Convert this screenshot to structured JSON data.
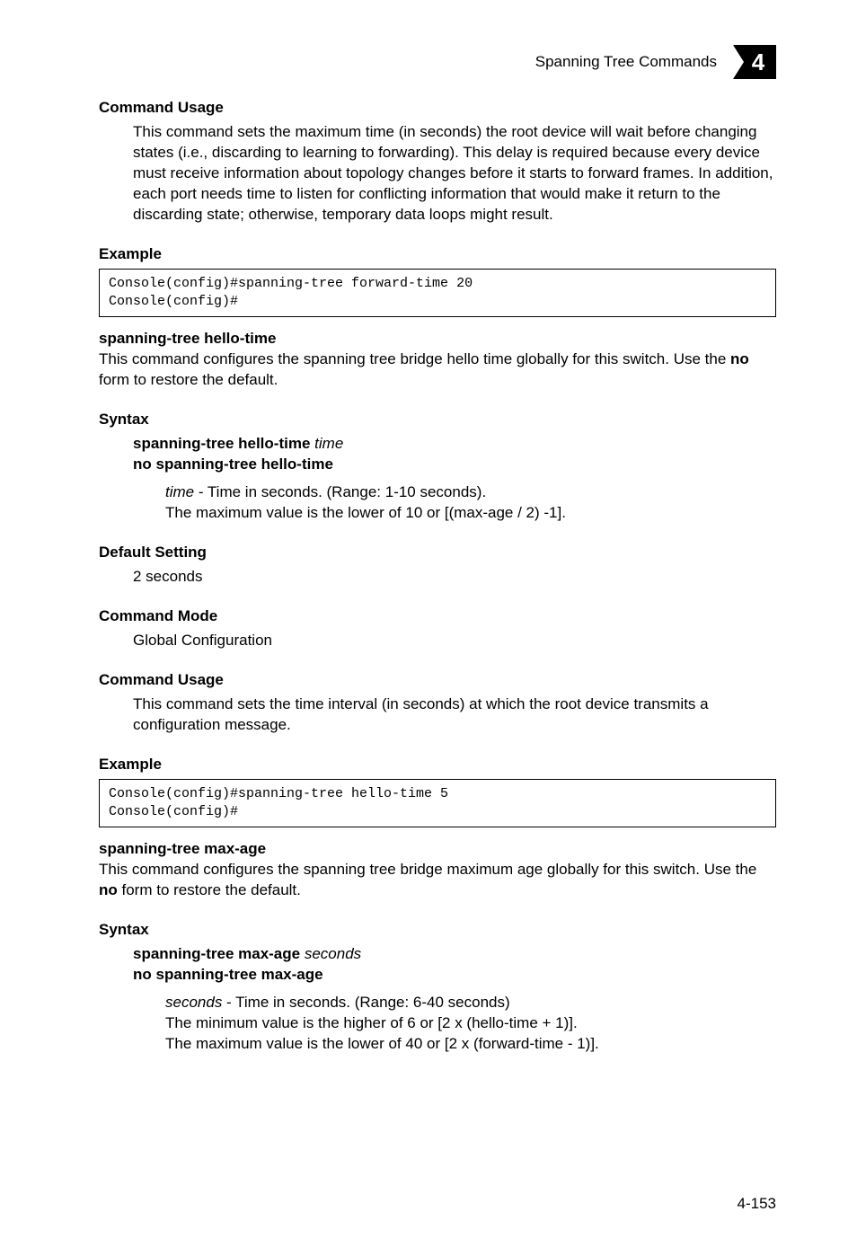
{
  "header": {
    "title": "Spanning Tree Commands",
    "chapter": "4"
  },
  "sec1": {
    "h": "Command Usage",
    "p": "This command sets the maximum time (in seconds) the root device will wait before changing states (i.e., discarding to learning to forwarding). This delay is required because every device must receive information about topology changes before it starts to forward frames. In addition, each port needs time to listen for conflicting information that would make it return to the discarding state; otherwise, temporary data loops might result."
  },
  "ex1": {
    "h": "Example",
    "code": "Console(config)#spanning-tree forward-time 20\nConsole(config)#"
  },
  "cmd1": {
    "name": "spanning-tree hello-time",
    "desc1": "This command configures the spanning tree bridge hello time globally for this switch. Use the ",
    "desc_bold": "no",
    "desc2": " form to restore the default."
  },
  "syn1": {
    "h": "Syntax",
    "l1a": "spanning-tree hello-time",
    "l1b": "time",
    "l2": "no spanning-tree hello-time",
    "p1a": "time",
    "p1b": " - Time in seconds. (Range: 1-10 seconds).",
    "p2": "The maximum value is the lower of 10 or [(max-age / 2) -1]."
  },
  "def1": {
    "h": "Default Setting",
    "p": "2 seconds"
  },
  "mode1": {
    "h": "Command Mode",
    "p": "Global Configuration"
  },
  "usage1": {
    "h": "Command Usage",
    "p": "This command sets the time interval (in seconds) at which the root device transmits a configuration message."
  },
  "ex2": {
    "h": "Example",
    "code": "Console(config)#spanning-tree hello-time 5\nConsole(config)#"
  },
  "cmd2": {
    "name": "spanning-tree max-age",
    "desc1": "This command configures the spanning tree bridge maximum age globally for this switch. Use the ",
    "desc_bold": "no",
    "desc2": " form to restore the default."
  },
  "syn2": {
    "h": "Syntax",
    "l1a": "spanning-tree max-age",
    "l1b": "seconds",
    "l2": "no spanning-tree max-age",
    "p1a": "seconds",
    "p1b": " - Time in seconds. (Range: 6-40 seconds)",
    "p2": "The minimum value is the higher of 6 or [2 x (hello-time + 1)].",
    "p3": "The maximum value is the lower of 40 or [2 x (forward-time - 1)]."
  },
  "pagenum": "4-153"
}
